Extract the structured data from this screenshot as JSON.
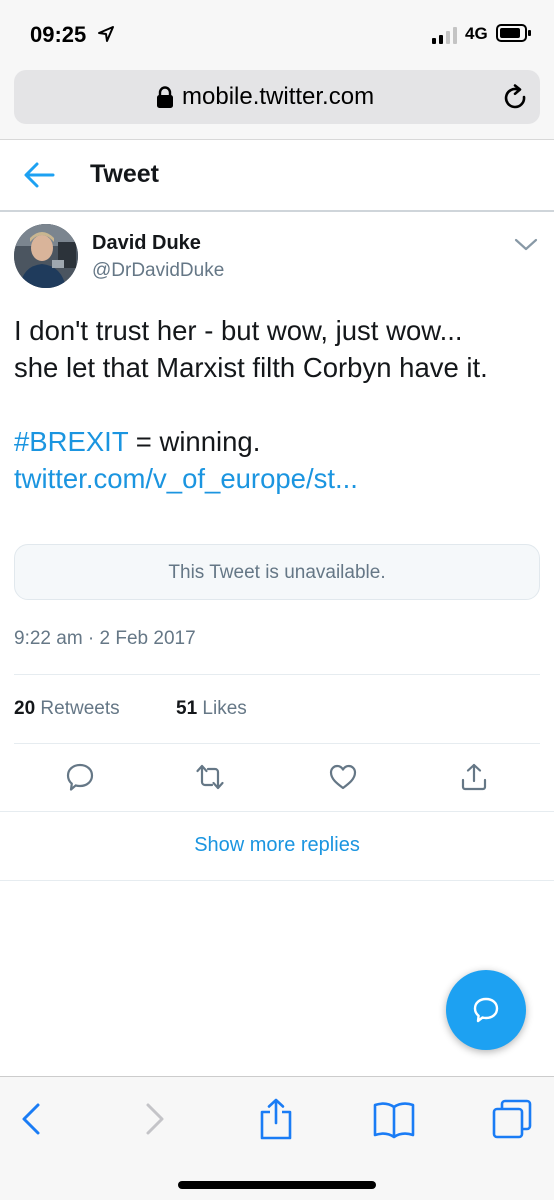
{
  "status_bar": {
    "time": "09:25",
    "network": "4G"
  },
  "browser": {
    "url": "mobile.twitter.com"
  },
  "header": {
    "title": "Tweet"
  },
  "tweet": {
    "author_name": "David Duke",
    "author_handle": "@DrDavidDuke",
    "text_line_1": "I don't trust her - but wow, just wow...",
    "text_line_2": "she let that Marxist filth Corbyn have it.",
    "hashtag": "#BREXIT",
    "text_after_hashtag": " = winning.",
    "link": "twitter.com/v_of_europe/st...",
    "quoted_status": "This Tweet is unavailable.",
    "timestamp": "9:22 am · 2 Feb 2017",
    "retweets_count": "20",
    "retweets_label": "Retweets",
    "likes_count": "51",
    "likes_label": "Likes"
  },
  "actions": {
    "icons": [
      "reply-icon",
      "retweet-icon",
      "like-icon",
      "share-icon"
    ]
  },
  "replies": {
    "show_more": "Show more replies"
  },
  "colors": {
    "twitter_blue": "#1da1f2",
    "link_blue": "#1b95e0",
    "secondary_text": "#657786",
    "safari_blue": "#1a7cf5"
  }
}
